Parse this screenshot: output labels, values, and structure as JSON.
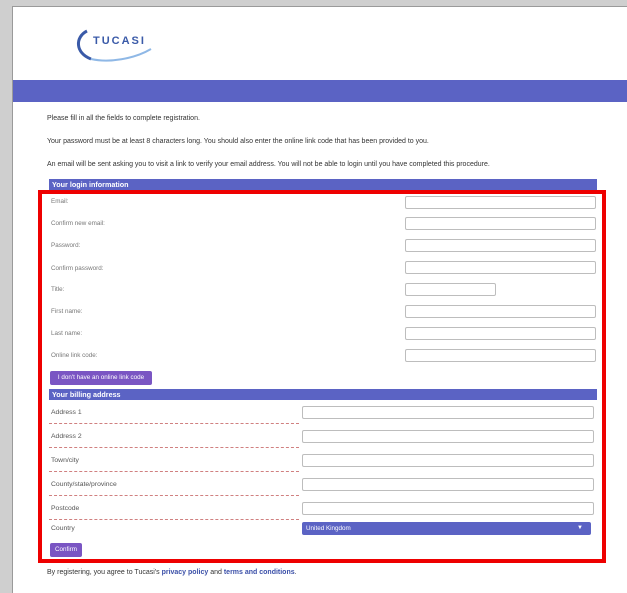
{
  "brand": {
    "name": "TUCASI"
  },
  "intro": [
    "Please fill in all the fields to complete registration.",
    "Your password must be at least 8 characters long. You should also enter the online link code that has been provided to you.",
    "An email will be sent asking you to visit a link to verify your email address. You will not be able to login until you have completed this procedure."
  ],
  "login_section": {
    "title": "Your login information",
    "fields": [
      "Email:",
      "Confirm new email:",
      "Password:",
      "Confirm password:",
      "Title:",
      "First name:",
      "Last name:",
      "Online link code:"
    ],
    "no_code_button": "I don't have an online link code"
  },
  "billing_section": {
    "title": "Your billing address",
    "fields": [
      "Address 1",
      "Address 2",
      "Town/city",
      "County/state/province",
      "Postcode"
    ],
    "country_label": "Country",
    "country_value": "United Kingdom"
  },
  "confirm_button": "Confirm",
  "footer": {
    "prefix": "By registering, you agree to Tucasi's ",
    "privacy": "privacy policy",
    "and": " and ",
    "terms": "terms and conditions",
    "suffix": "."
  },
  "colors": {
    "accent": "#5b63c4",
    "button": "#7a55c3",
    "highlight": "#ee0000"
  }
}
